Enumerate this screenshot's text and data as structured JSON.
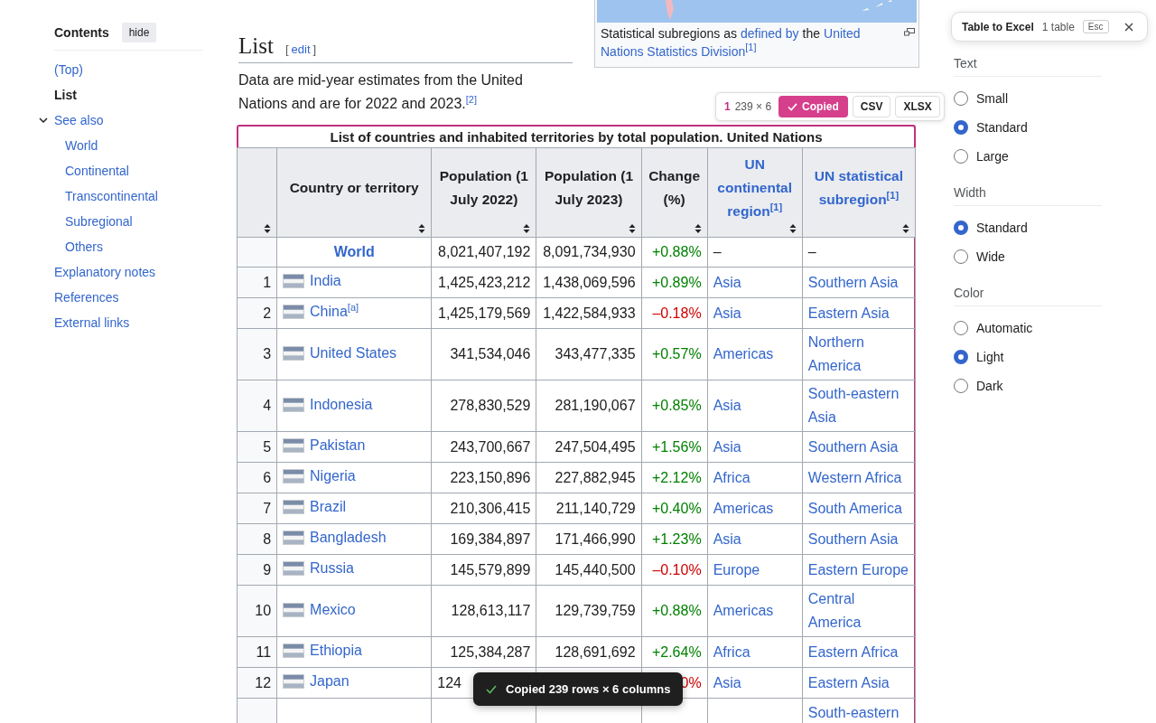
{
  "sidebar": {
    "title": "Contents",
    "hide_button": "hide",
    "items": [
      {
        "label": "(Top)",
        "selected": false
      },
      {
        "label": "List",
        "selected": true
      },
      {
        "label": "See also",
        "selected": false,
        "expanded": true,
        "children": [
          {
            "label": "World",
            "selected": false
          },
          {
            "label": "Continental",
            "selected": false
          },
          {
            "label": "Transcontinental",
            "selected": false
          },
          {
            "label": "Subregional",
            "selected": false
          },
          {
            "label": "Others",
            "selected": false
          }
        ]
      },
      {
        "label": "Explanatory notes",
        "selected": false
      },
      {
        "label": "References",
        "selected": false
      },
      {
        "label": "External links",
        "selected": false
      }
    ]
  },
  "section": {
    "heading": "List",
    "edit_open": "[",
    "edit_link": "edit",
    "edit_close": "]",
    "intro": "Data are mid-year estimates from the United Nations and are for 2022 and 2023.$^{[2]}$"
  },
  "figure": {
    "caption_lines": [
      [
        {
          "text": "Statistical subregions as",
          "link": false
        },
        {
          "text": "defined by",
          "link": true
        },
        {
          "text": "the",
          "link": false
        },
        {
          "text": "United",
          "link": true
        }
      ],
      [
        {
          "text": "Nations Statistics Division$^{[1]}$",
          "link": true
        }
      ]
    ]
  },
  "toolbar": {
    "index": "1",
    "size": "239 × 6",
    "copied_button": "Copied",
    "buttons": [
      "CSV",
      "XLSX"
    ]
  },
  "table": {
    "caption": "List of countries and inhabited territories by total population. United Nations",
    "columns": [
      {},
      {
        "label": "Country or territory",
        "link": false
      },
      {
        "label": "Population (1 July 2022)",
        "link": false
      },
      {
        "label": "Population (1 July 2023)",
        "link": false
      },
      {
        "label": "Change (%)",
        "link": false
      },
      {
        "label": "UN continental region$^{[1]}$",
        "link": true
      },
      {
        "label": "UN statistical subregion$^{[1]}$",
        "link": true
      }
    ],
    "rows": [
      {
        "country": "World",
        "bold": true,
        "pop_2022": "8,021,407,192",
        "pop_2023": "8,091,734,930",
        "change": "+0.88%",
        "negative": false,
        "region": "–",
        "subregion": "–",
        "region_link": false
      },
      {
        "rank": "1",
        "country": "India",
        "flag": true,
        "pop_2022": "1,425,423,212",
        "pop_2023": "1,438,069,596",
        "change": "+0.89%",
        "negative": false,
        "region": "Asia",
        "subregion": "Southern Asia",
        "region_link": true
      },
      {
        "rank": "2",
        "country": "China$^{[a]}$",
        "flag": true,
        "pop_2022": "1,425,179,569",
        "pop_2023": "1,422,584,933",
        "change": "–0.18%",
        "negative": true,
        "region": "Asia",
        "subregion": "Eastern Asia",
        "region_link": true
      },
      {
        "rank": "3",
        "country": "United States",
        "flag": true,
        "pop_2022": "341,534,046",
        "pop_2023": "343,477,335",
        "change": "+0.57%",
        "negative": false,
        "region": "Americas",
        "subregion": "Northern America",
        "region_link": true
      },
      {
        "rank": "4",
        "country": "Indonesia",
        "flag": true,
        "pop_2022": "278,830,529",
        "pop_2023": "281,190,067",
        "change": "+0.85%",
        "negative": false,
        "region": "Asia",
        "subregion": "South-eastern Asia",
        "region_link": true
      },
      {
        "rank": "5",
        "country": "Pakistan",
        "flag": true,
        "pop_2022": "243,700,667",
        "pop_2023": "247,504,495",
        "change": "+1.56%",
        "negative": false,
        "region": "Asia",
        "subregion": "Southern Asia",
        "region_link": true
      },
      {
        "rank": "6",
        "country": "Nigeria",
        "flag": true,
        "pop_2022": "223,150,896",
        "pop_2023": "227,882,945",
        "change": "+2.12%",
        "negative": false,
        "region": "Africa",
        "subregion": "Western Africa",
        "region_link": true
      },
      {
        "rank": "7",
        "country": "Brazil",
        "flag": true,
        "pop_2022": "210,306,415",
        "pop_2023": "211,140,729",
        "change": "+0.40%",
        "negative": false,
        "region": "Americas",
        "subregion": "South America",
        "region_link": true
      },
      {
        "rank": "8",
        "country": "Bangladesh",
        "flag": true,
        "pop_2022": "169,384,897",
        "pop_2023": "171,466,990",
        "change": "+1.23%",
        "negative": false,
        "region": "Asia",
        "subregion": "Southern Asia",
        "region_link": true
      },
      {
        "rank": "9",
        "country": "Russia",
        "flag": true,
        "pop_2022": "145,579,899",
        "pop_2023": "145,440,500",
        "change": "–0.10%",
        "negative": true,
        "region": "Europe",
        "subregion": "Eastern Europe",
        "region_link": true
      },
      {
        "rank": "10",
        "country": "Mexico",
        "flag": true,
        "pop_2022": "128,613,117",
        "pop_2023": "129,739,759",
        "change": "+0.88%",
        "negative": false,
        "region": "Americas",
        "subregion": "Central America",
        "region_link": true
      },
      {
        "rank": "11",
        "country": "Ethiopia",
        "flag": true,
        "pop_2022": "125,384,287",
        "pop_2023": "128,691,692",
        "change": "+2.64%",
        "negative": false,
        "region": "Africa",
        "subregion": "Eastern Africa",
        "region_link": true
      },
      {
        "rank": "12",
        "country": "Japan",
        "flag": true,
        "pop_2022": "124",
        "obscured": true,
        "change": "0%",
        "negative": true,
        "region": "Asia",
        "subregion": "Eastern Asia",
        "region_link": true
      },
      {
        "subregion": "South-eastern",
        "region_link": true
      }
    ]
  },
  "toast": {
    "text": "Copied 239 rows × 6 columns"
  },
  "excel_popup": {
    "title": "Table to Excel",
    "count": "1 table",
    "key": "Esc"
  },
  "appearance": [
    {
      "heading": "Text",
      "options": [
        {
          "label": "Small",
          "selected": false
        },
        {
          "label": "Standard",
          "selected": true
        },
        {
          "label": "Large",
          "selected": false
        }
      ]
    },
    {
      "heading": "Width",
      "options": [
        {
          "label": "Standard",
          "selected": true
        },
        {
          "label": "Wide",
          "selected": false
        }
      ]
    },
    {
      "heading": "Color",
      "options": [
        {
          "label": "Automatic",
          "selected": false
        },
        {
          "label": "Light",
          "selected": true
        },
        {
          "label": "Dark",
          "selected": false
        }
      ]
    }
  ]
}
